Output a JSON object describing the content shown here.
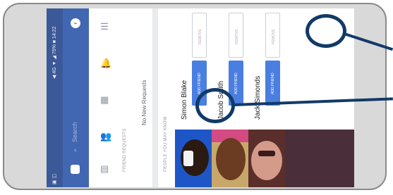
{
  "status_bar": {
    "text": "◀ 4G ▼ ◢ 75% ■ 14:22",
    "left_icons": "▣ ◫"
  },
  "app_bar": {
    "search_placeholder": "Search"
  },
  "tabs": [
    {
      "name": "feed",
      "icon": "▤"
    },
    {
      "name": "friends",
      "icon": "👥"
    },
    {
      "name": "marketplace",
      "icon": "▦"
    },
    {
      "name": "notifications",
      "icon": "🔔"
    },
    {
      "name": "menu",
      "icon": "☰"
    }
  ],
  "friend_requests": {
    "header": "FRIEND REQUESTS",
    "empty_text": "No New Requests"
  },
  "people_you_may_know": {
    "header": "PEOPLE YOU MAY KNOW",
    "people": [
      {
        "name": "Simon Blake",
        "add_label": "ADD FRIEND",
        "remove_label": "REMOVE"
      },
      {
        "name": "Jacob Smith",
        "add_label": "ADD FRIEND",
        "remove_label": "REMOVE"
      },
      {
        "name": "Jack Simonds",
        "add_label": "ADD FRIEND",
        "remove_label": "REMOVE"
      }
    ]
  },
  "messenger_icon": "⌁",
  "colors": {
    "brand": "#4267b2",
    "status_bar": "#3b5998",
    "button": "#4a7ee0",
    "annotation": "#123a67"
  }
}
